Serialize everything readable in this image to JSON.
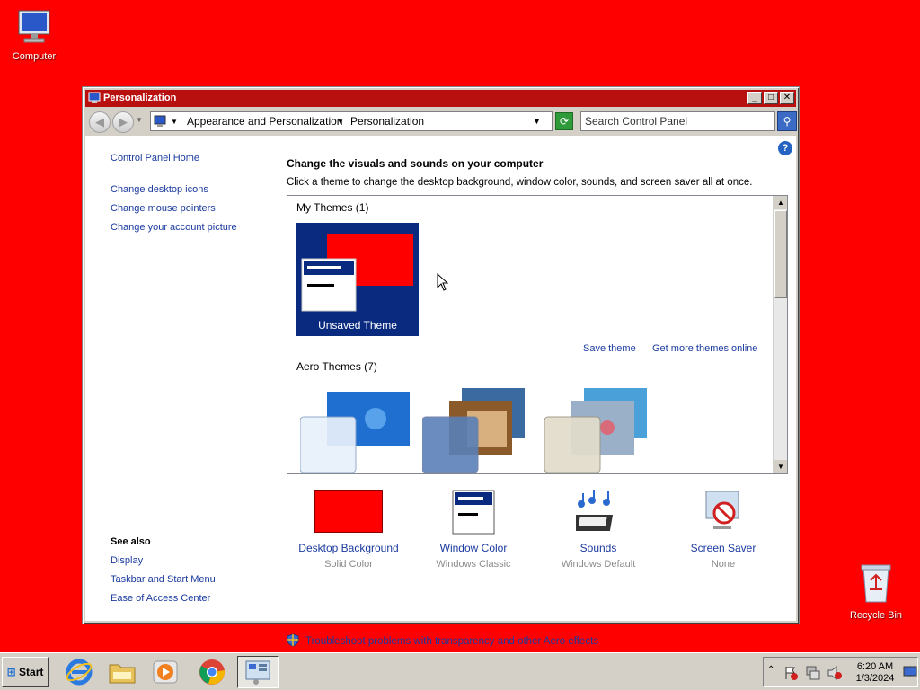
{
  "desktop": {
    "icons": [
      {
        "label": "Computer",
        "icon": "computer-icon"
      },
      {
        "label": "Recycle Bin",
        "icon": "recycle-bin-icon"
      }
    ]
  },
  "window": {
    "title": "Personalization",
    "controls": {
      "minimize": "_",
      "maximize": "□",
      "close": "✕"
    },
    "address": {
      "crumbs": [
        "Appearance and Personalization",
        "Personalization"
      ],
      "search_placeholder": "Search Control Panel"
    }
  },
  "left_nav": {
    "home": "Control Panel Home",
    "links": [
      "Change desktop icons",
      "Change mouse pointers",
      "Change your account picture"
    ],
    "see_also_title": "See also",
    "see_also": [
      "Display",
      "Taskbar and Start Menu",
      "Ease of Access Center"
    ]
  },
  "main": {
    "heading": "Change the visuals and sounds on your computer",
    "subtext": "Click a theme to change the desktop background, window color, sounds, and screen saver all at once.",
    "my_themes_label": "My Themes (1)",
    "unsaved_theme_label": "Unsaved Theme",
    "save_theme": "Save theme",
    "get_more_themes": "Get more themes online",
    "aero_themes_label": "Aero Themes (7)"
  },
  "bottom": {
    "items": [
      {
        "title": "Desktop Background",
        "subtitle": "Solid Color"
      },
      {
        "title": "Window Color",
        "subtitle": "Windows Classic"
      },
      {
        "title": "Sounds",
        "subtitle": "Windows Default"
      },
      {
        "title": "Screen Saver",
        "subtitle": "None"
      }
    ],
    "troubleshoot": "Troubleshoot problems with transparency and other Aero effects"
  },
  "taskbar": {
    "start_label": "Start",
    "apps": [
      "internet-explorer-icon",
      "file-explorer-icon",
      "media-player-icon",
      "chrome-icon",
      "control-panel-icon"
    ],
    "clock_time": "6:20 AM",
    "clock_date": "1/3/2024"
  },
  "colors": {
    "desktop": "#ff0000",
    "titlebar": "#b80f0f",
    "link": "#1a3a9e",
    "theme_tile": "#0a2a80"
  }
}
